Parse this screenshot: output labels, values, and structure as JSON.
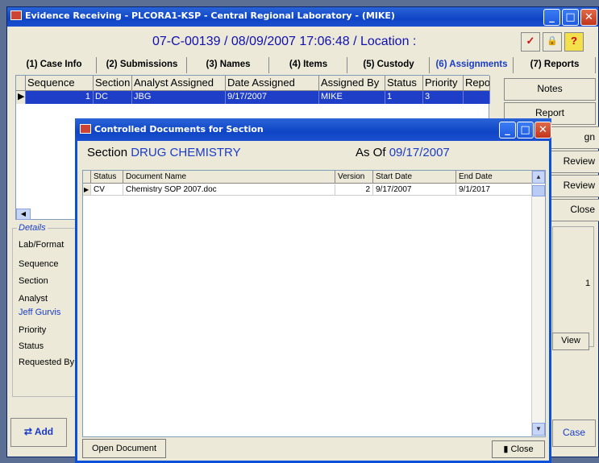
{
  "window": {
    "title": "Evidence Receiving - PLCORA1-KSP - Central Regional Laboratory - (MIKE)",
    "case_line": "07-C-00139 / 08/09/2007 17:06:48  / Location :"
  },
  "toolbar_icons": [
    "checkmark-icon",
    "lock-icon",
    "help-icon"
  ],
  "toolbar_glyphs": {
    "check": "✓",
    "lock": "🔒",
    "help": "?"
  },
  "tabs": [
    {
      "label": "(1) Case Info"
    },
    {
      "label": "(2) Submissions"
    },
    {
      "label": "(3) Names"
    },
    {
      "label": "(4) Items"
    },
    {
      "label": "(5) Custody"
    },
    {
      "label": "(6) Assignments"
    },
    {
      "label": "(7) Reports"
    }
  ],
  "assign_grid": {
    "headers": [
      "Sequence",
      "Section",
      "Analyst Assigned",
      "Date Assigned",
      "Assigned By",
      "Status",
      "Priority",
      "Repo"
    ],
    "rows": [
      {
        "sequence": "1",
        "section": "DC",
        "analyst": "JBG",
        "date": "9/17/2007",
        "assigned_by": "MIKE",
        "status": "1",
        "priority": "3",
        "repo": ""
      }
    ]
  },
  "side_buttons": {
    "notes": "Notes",
    "report": "Report",
    "sign": "gn",
    "review1": "Review",
    "review2": "Review",
    "close": "Close",
    "view": "View",
    "case": "Case"
  },
  "partial_values": {
    "right_cell": "1"
  },
  "details": {
    "legend": "Details",
    "lab_format": "Lab/Format",
    "sequence": "Sequence",
    "section": "Section",
    "analyst": "Analyst",
    "analyst_value": "Jeff Gurvis",
    "priority": "Priority",
    "status": "Status",
    "requested_by": "Requested By"
  },
  "add_button": "Add",
  "dialog": {
    "title": "Controlled Documents for Section",
    "section_label": "Section",
    "section_value": "DRUG CHEMISTRY",
    "as_of_label": "As Of",
    "as_of_value": "09/17/2007",
    "headers": [
      "Status",
      "Document Name",
      "Version",
      "Start Date",
      "End Date"
    ],
    "rows": [
      {
        "status": "CV",
        "document": "Chemistry SOP 2007.doc",
        "version": "2",
        "start": "9/17/2007",
        "end": "9/1/2017"
      }
    ],
    "open_button": "Open Document",
    "close_button": "Close"
  },
  "colors": {
    "accent_blue": "#1a3cc8",
    "selected_row": "#1f3ec7",
    "title_bar": "#0f45c5"
  }
}
